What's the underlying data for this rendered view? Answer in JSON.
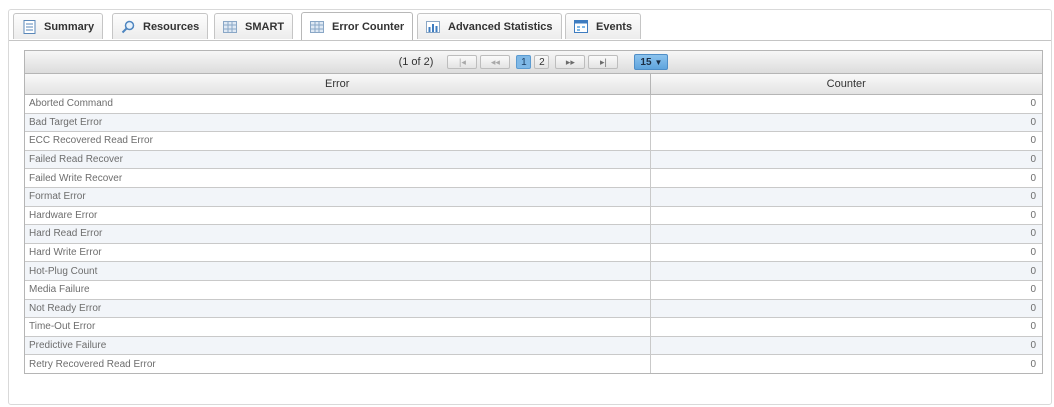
{
  "tabs": [
    {
      "label": "Summary",
      "icon": "document-icon",
      "active": false
    },
    {
      "label": "Resources",
      "icon": "magnifier-icon",
      "active": false
    },
    {
      "label": "SMART",
      "icon": "grid-icon",
      "active": false
    },
    {
      "label": "Error Counter",
      "icon": "grid-icon",
      "active": true
    },
    {
      "label": "Advanced Statistics",
      "icon": "bar-chart-icon",
      "active": false
    },
    {
      "label": "Events",
      "icon": "calendar-icon",
      "active": false
    }
  ],
  "paginator": {
    "current_text": "(1 of 2)",
    "first_label": "|◂",
    "prev_label": "◂◂",
    "pages": [
      "1",
      "2"
    ],
    "next_label": "▸▸",
    "last_label": "▸|",
    "rows_per_page": "15"
  },
  "table": {
    "columns": [
      "Error",
      "Counter"
    ],
    "rows": [
      {
        "error": "Aborted Command",
        "counter": "0"
      },
      {
        "error": "Bad Target Error",
        "counter": "0"
      },
      {
        "error": "ECC Recovered Read Error",
        "counter": "0"
      },
      {
        "error": "Failed Read Recover",
        "counter": "0"
      },
      {
        "error": "Failed Write Recover",
        "counter": "0"
      },
      {
        "error": "Format Error",
        "counter": "0"
      },
      {
        "error": "Hardware Error",
        "counter": "0"
      },
      {
        "error": "Hard Read Error",
        "counter": "0"
      },
      {
        "error": "Hard Write Error",
        "counter": "0"
      },
      {
        "error": "Hot-Plug Count",
        "counter": "0"
      },
      {
        "error": "Media Failure",
        "counter": "0"
      },
      {
        "error": "Not Ready Error",
        "counter": "0"
      },
      {
        "error": "Time-Out Error",
        "counter": "0"
      },
      {
        "error": "Predictive Failure",
        "counter": "0"
      },
      {
        "error": "Retry Recovered Read Error",
        "counter": "0"
      }
    ]
  },
  "colors": {
    "accent": "#7fb8e6",
    "row_alt": "#f2f5f9",
    "border": "#b5b5b5"
  }
}
